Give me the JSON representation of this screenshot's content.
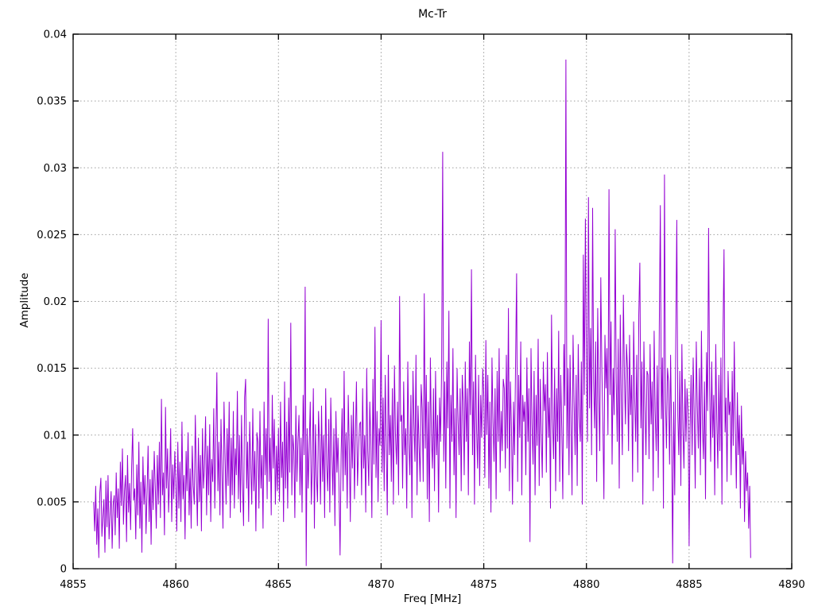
{
  "chart_data": {
    "type": "line",
    "title": "Mc-Tr",
    "xlabel": "Freq [MHz]",
    "ylabel": "Amplitude",
    "xlim": [
      4855,
      4890
    ],
    "ylim": [
      0,
      0.04
    ],
    "grid": true,
    "grid_style": "dotted",
    "legend": false,
    "line_color": "#9400d3",
    "grid_color": "#9e9e9e",
    "frame_color": "#000000",
    "x_tick_values": [
      4855,
      4860,
      4865,
      4870,
      4875,
      4880,
      4885,
      4890
    ],
    "x_tick_labels": [
      "4855",
      "4860",
      "4865",
      "4870",
      "4875",
      "4880",
      "4885",
      "4890"
    ],
    "y_tick_values": [
      0,
      0.005,
      0.01,
      0.015,
      0.02,
      0.025,
      0.03,
      0.035,
      0.04
    ],
    "y_tick_labels": [
      "0",
      "0.005",
      "0.01",
      "0.015",
      "0.02",
      "0.025",
      "0.03",
      "0.035",
      "0.04"
    ],
    "series": [
      {
        "name": "amplitude",
        "x_start_mhz": 4856.0,
        "x_step_mhz": 0.05,
        "y_scale": 0.0001,
        "y_x1e4": [
          50,
          28,
          62,
          18,
          45,
          8,
          57,
          68,
          24,
          39,
          52,
          12,
          66,
          31,
          70,
          22,
          41,
          58,
          15,
          48,
          55,
          25,
          72,
          38,
          60,
          15,
          80,
          47,
          90,
          33,
          58,
          70,
          20,
          85,
          42,
          64,
          29,
          76,
          105,
          51,
          60,
          22,
          78,
          40,
          95,
          30,
          65,
          12,
          84,
          48,
          70,
          26,
          58,
          92,
          35,
          67,
          18,
          74,
          44,
          88,
          62,
          30,
          85,
          48,
          95,
          38,
          127,
          55,
          72,
          25,
          121,
          60,
          90,
          42,
          68,
          105,
          35,
          78,
          52,
          88,
          65,
          28,
          95,
          45,
          80,
          35,
          110,
          52,
          70,
          22,
          88,
          58,
          102,
          40,
          75,
          30,
          92,
          62,
          48,
          115,
          70,
          32,
          98,
          50,
          85,
          28,
          105,
          60,
          78,
          114,
          40,
          92,
          55,
          108,
          35,
          82,
          65,
          120,
          45,
          95,
          147,
          58,
          95,
          40,
          112,
          70,
          30,
          125,
          85,
          48,
          105,
          62,
          125,
          38,
          98,
          55,
          118,
          45,
          90,
          70,
          133,
          52,
          100,
          42,
          115,
          65,
          32,
          128,
          142,
          60,
          95,
          35,
          110,
          78,
          48,
          120,
          58,
          88,
          28,
          102,
          95,
          45,
          118,
          60,
          85,
          30,
          125,
          70,
          105,
          52,
          187,
          65,
          98,
          40,
          130,
          75,
          112,
          48,
          92,
          58,
          105,
          50,
          125,
          68,
          95,
          35,
          140,
          60,
          110,
          45,
          128,
          72,
          184,
          55,
          100,
          88,
          38,
          122,
          65,
          95,
          115,
          55,
          98,
          42,
          130,
          85,
          211,
          2,
          105,
          60,
          92,
          125,
          48,
          78,
          135,
          30,
          108,
          70,
          50,
          118,
          95,
          48,
          122,
          65,
          100,
          38,
          135,
          78,
          58,
          112,
          42,
          128,
          88,
          55,
          105,
          32,
          118,
          72,
          98,
          60,
          10,
          85,
          120,
          58,
          148,
          70,
          102,
          45,
          130,
          90,
          35,
          115,
          75,
          125,
          52,
          98,
          140,
          62,
          88,
          108,
          110,
          55,
          135,
          75,
          100,
          42,
          150,
          88,
          62,
          125,
          95,
          38,
          142,
          78,
          181,
          68,
          118,
          50,
          105,
          92,
          186,
          72,
          128,
          58,
          145,
          95,
          40,
          160,
          85,
          115,
          65,
          135,
          48,
          152,
          100,
          78,
          125,
          55,
          204,
          110,
          115,
          60,
          140,
          85,
          105,
          45,
          155,
          95,
          70,
          130,
          38,
          148,
          108,
          80,
          160,
          55,
          122,
          92,
          65,
          138,
          120,
          65,
          206,
          90,
          145,
          52,
          125,
          35,
          158,
          100,
          75,
          135,
          58,
          148,
          85,
          115,
          42,
          128,
          95,
          152,
          312,
          80,
          140,
          60,
          155,
          105,
          193,
          45,
          130,
          95,
          165,
          70,
          120,
          38,
          150,
          110,
          85,
          135,
          58,
          145,
          125,
          70,
          155,
          95,
          135,
          55,
          170,
          115,
          224,
          85,
          140,
          48,
          160,
          105,
          75,
          145,
          62,
          130,
          98,
          150,
          130,
          68,
          171,
          100,
          145,
          60,
          125,
          42,
          158,
          110,
          80,
          135,
          52,
          148,
          95,
          165,
          72,
          118,
          88,
          142,
          135,
          75,
          160,
          90,
          195,
          58,
          140,
          105,
          48,
          125,
          85,
          155,
          221,
          65,
          145,
          98,
          170,
          55,
          130,
          110,
          125,
          70,
          158,
          95,
          135,
          20,
          165,
          108,
          78,
          148,
          55,
          130,
          92,
          172,
          62,
          142,
          100,
          68,
          155,
          118,
          138,
          72,
          162,
          98,
          128,
          45,
          190,
          112,
          82,
          150,
          58,
          135,
          95,
          178,
          65,
          145,
          105,
          52,
          168,
          122,
          381,
          90,
          150,
          70,
          160,
          110,
          55,
          175,
          125,
          85,
          145,
          62,
          168,
          115,
          95,
          155,
          48,
          235,
          130,
          262,
          160,
          95,
          278,
          120,
          180,
          85,
          270,
          140,
          105,
          170,
          65,
          195,
          130,
          88,
          218,
          150,
          110,
          52,
          175,
          135,
          165,
          100,
          284,
          130,
          185,
          78,
          150,
          115,
          254,
          140,
          95,
          172,
          60,
          190,
          125,
          85,
          205,
          145,
          108,
          168,
          150,
          88,
          175,
          115,
          145,
          65,
          185,
          128,
          95,
          160,
          72,
          190,
          229,
          105,
          155,
          48,
          170,
          122,
          85,
          148,
          145,
          82,
          168,
          108,
          140,
          58,
          178,
          118,
          88,
          152,
          68,
          182,
          272,
          112,
          158,
          45,
          295,
          125,
          90,
          150,
          140,
          78,
          160,
          100,
          4,
          125,
          55,
          172,
          261,
          115,
          85,
          148,
          62,
          168,
          105,
          75,
          142,
          95,
          135,
          118,
          17,
          105,
          145,
          85,
          158,
          115,
          60,
          170,
          122,
          90,
          150,
          70,
          178,
          108,
          82,
          140,
          52,
          162,
          118,
          255,
          135,
          80,
          155,
          98,
          130,
          55,
          168,
          112,
          75,
          145,
          88,
          158,
          48,
          175,
          239,
          102,
          128,
          65,
          148,
          115,
          125,
          70,
          148,
          92,
          170,
          105,
          60,
          132,
          85,
          115,
          45,
          122,
          78,
          98,
          35,
          88,
          58,
          72,
          30,
          62,
          8
        ]
      }
    ]
  }
}
